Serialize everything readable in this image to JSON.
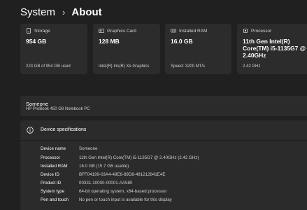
{
  "breadcrumb": {
    "parent": "System",
    "separator": "›",
    "current": "About"
  },
  "cards": [
    {
      "icon": "storage-icon",
      "title": "Storage",
      "value": "954 GB",
      "detail": "223 GB of 954 GB used"
    },
    {
      "icon": "graphics-card-icon",
      "title": "Graphics Card",
      "value": "128 MB",
      "detail": "Intel(R) Iris(R) Xe Graphics"
    },
    {
      "icon": "ram-icon",
      "title": "Installed RAM",
      "value": "16.0 GB",
      "detail": "Speed: 3200 MT/s"
    },
    {
      "icon": "processor-icon",
      "title": "Processor",
      "value": "11th Gen Intel(R) Core(TM) i5-1135G7 @ 2.40GHz",
      "detail": "2.42 GHz"
    }
  ],
  "device": {
    "name": "Someone",
    "model": "HP ProBook 450 G8 Notebook PC"
  },
  "specs": {
    "title": "Device specifications",
    "rows": [
      {
        "label": "Device name",
        "value": "Someone"
      },
      {
        "label": "Processor",
        "value": "11th Gen Intel(R) Core(TM) i5-1135G7 @ 2.40GHz (2.42 GHz)"
      },
      {
        "label": "Installed RAM",
        "value": "16.0 GB (15.7 GB usable)"
      },
      {
        "label": "Device ID",
        "value": "BFF04199-03A4-48E6-89D8-491212841E4E"
      },
      {
        "label": "Product ID",
        "value": "00331-10000-00001-AA580"
      },
      {
        "label": "System type",
        "value": "64-bit operating system, x64-based processor"
      },
      {
        "label": "Pen and touch",
        "value": "No pen or touch input is available for this display"
      }
    ]
  },
  "colors": {
    "background": "#202020",
    "card": "#2c2c2c",
    "text": "#ffffff",
    "muted": "#cfcfcf"
  }
}
